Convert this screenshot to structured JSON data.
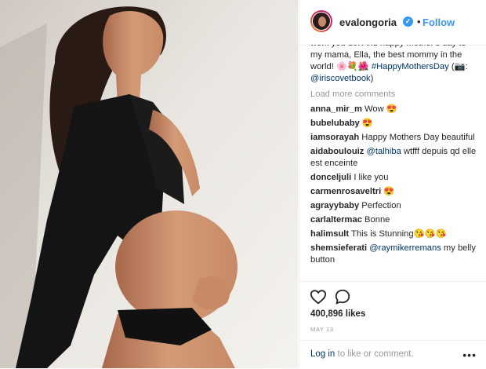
{
  "header": {
    "username": "evalongoria",
    "follow_label": "Follow",
    "separator": "•"
  },
  "caption": {
    "text_part1": "work you do. And happy Mother's day to my mama, Ella, the best mommy in the world! ",
    "emojis": "🌸💐🌺",
    "hashtag": "#HappyMothersDay",
    "credit_prefix": " (📷: ",
    "mention": "@iriscovetbook",
    "credit_suffix": ")"
  },
  "load_more_label": "Load more comments",
  "comments": [
    {
      "user": "anna_mir_m",
      "text": "Wow 😍"
    },
    {
      "user": "bubelubaby",
      "text": "😍"
    },
    {
      "user": "iamsorayah",
      "text": "Happy Mothers Day beautiful"
    },
    {
      "user": "aidaboulouiz",
      "mention": "@talhiba",
      "text": " wtfff depuis qd elle est enceinte"
    },
    {
      "user": "donceljuli",
      "text": "I like you"
    },
    {
      "user": "carmenrosaveltri",
      "text": "😍"
    },
    {
      "user": "agrayybaby",
      "text": "Perfection"
    },
    {
      "user": "carlaltermac",
      "text": "Bonne"
    },
    {
      "user": "halimsult",
      "text": "This is Stunning😘😘😘"
    },
    {
      "user": "shemsieferati",
      "mention": "@raymikerremans",
      "text": " my belly button"
    }
  ],
  "likes": "400,896 likes",
  "date": "MAY 13",
  "footer": {
    "login_label": "Log in",
    "rest_text": " to like or comment.",
    "more_icon": "•••"
  },
  "icons": {
    "heart": "heart-icon",
    "comment": "comment-icon",
    "verified": "verified-badge-icon",
    "more": "more-options-icon"
  },
  "colors": {
    "link_blue": "#3897f0",
    "hashtag_blue": "#003569",
    "muted": "#999999",
    "text": "#262626"
  }
}
